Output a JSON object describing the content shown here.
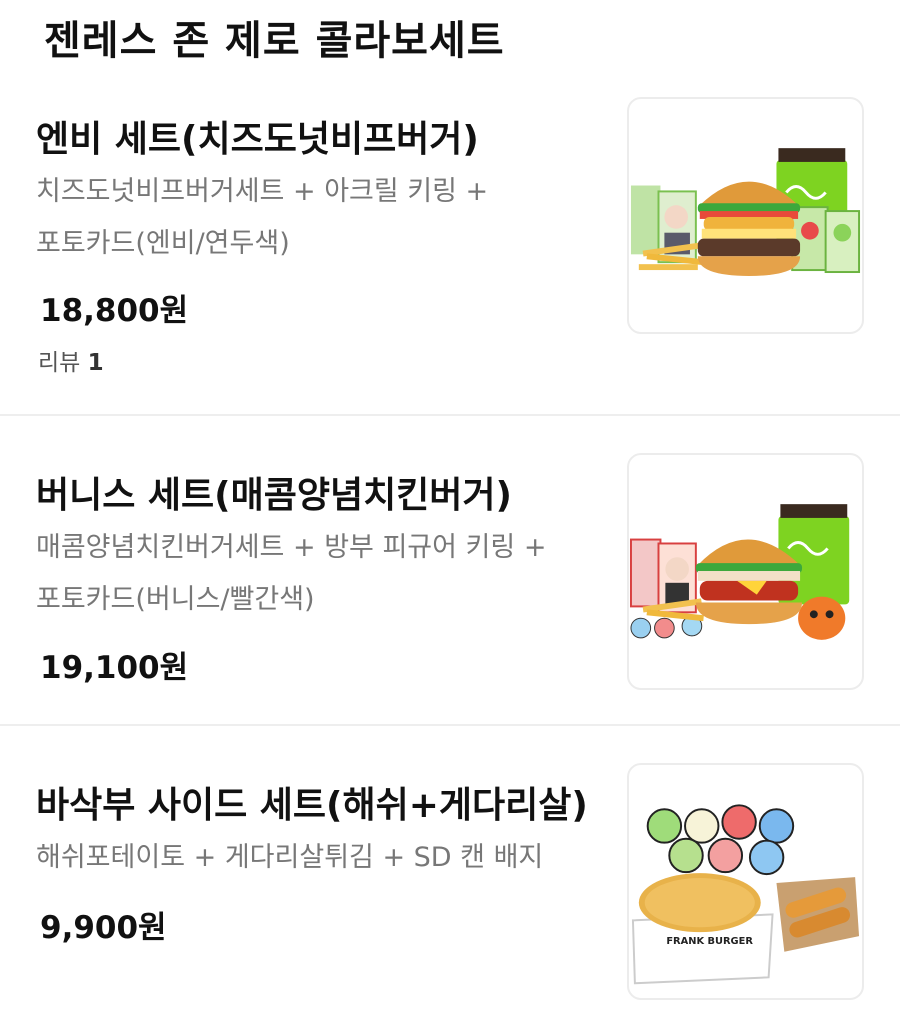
{
  "section": {
    "title": "젠레스 존 제로 콜라보세트"
  },
  "items": [
    {
      "name": "엔비 세트(치즈도넛비프버거)",
      "desc_line1": "치즈도넛비프버거세트 + 아크릴 키링 +",
      "desc_line2": "포토카드(엔비/연두색)",
      "price": "18,800원",
      "review_label": "리뷰",
      "review_count": "1"
    },
    {
      "name": "버니스 세트(매콤양념치킨버거)",
      "desc_line1": "매콤양념치킨버거세트 + 방부 피규어 키링 +",
      "desc_line2": "포토카드(버니스/빨간색)",
      "price": "19,100원"
    },
    {
      "name": "바삭부 사이드 세트(해쉬+게다리살)",
      "desc_line1": "해쉬포테이토 + 게다리살튀김 + SD 캔 배지",
      "price": "9,900원",
      "image_text_brand": "FRANK BURGER"
    }
  ],
  "colors": {
    "drink": "#7ed321",
    "bun": "#e09a3a",
    "lettuce": "#3ca83c",
    "divider": "#eeeeee"
  }
}
